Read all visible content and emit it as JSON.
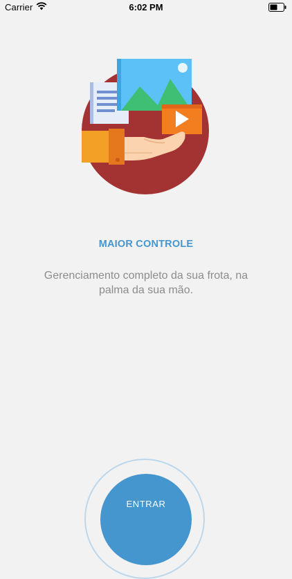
{
  "status_bar": {
    "carrier": "Carrier",
    "time": "6:02 PM",
    "wifi_icon": "wifi-icon",
    "battery_icon": "battery-icon"
  },
  "onboarding": {
    "illustration_icon": "hand-holding-media-icon",
    "title": "MAIOR CONTROLE",
    "description": "Gerenciamento completo da sua frota, na palma da sua mão."
  },
  "actions": {
    "enter_label": "ENTRAR"
  },
  "colors": {
    "background": "#f2f2f2",
    "accent": "#4596cf",
    "illustration_circle": "#a33332",
    "text_muted": "#8c8c8c"
  }
}
